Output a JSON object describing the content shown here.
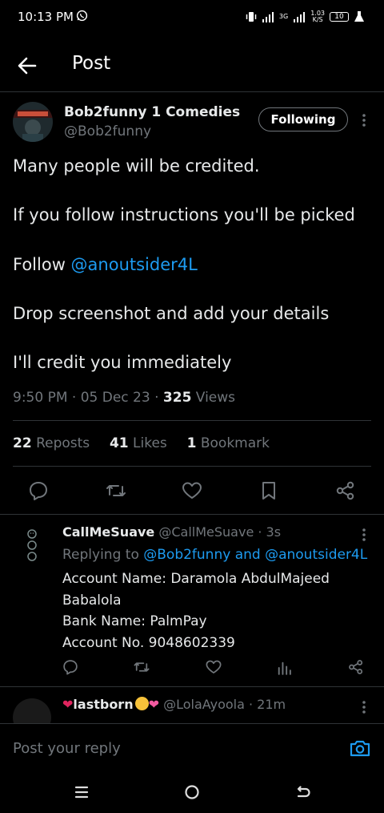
{
  "status": {
    "time": "10:13 PM",
    "network_top": "3G",
    "speed_value": "1.03",
    "speed_unit": "K/S",
    "battery": "10"
  },
  "header": {
    "title": "Post"
  },
  "tweet": {
    "author_name": "Bob2funny 1 Comedies",
    "author_handle": "@Bob2funny",
    "follow_label": "Following",
    "lines": [
      "Many people will be credited.",
      "If you follow instructions you'll be picked",
      "Follow ",
      "Drop screenshot and add your details",
      "I'll credit you immediately"
    ],
    "mention": "@anoutsider4L",
    "time": "9:50 PM",
    "sep1": " · ",
    "date": "05 Dec 23",
    "sep2": " · ",
    "views_count": "325",
    "views_label": " Views",
    "reposts_count": "22",
    "reposts_label": " Reposts",
    "likes_count": "41",
    "likes_label": " Likes",
    "bookmarks_count": "1",
    "bookmarks_label": " Bookmark"
  },
  "replies": [
    {
      "name": "CallMeSuave",
      "handle": " @CallMeSuave · 3s",
      "replying_prefix": "Replying to ",
      "replying_targets": "@Bob2funny and @anoutsider4L",
      "body": [
        "Account Name: Daramola AbdulMajeed",
        "Babalola",
        "Bank Name: PalmPay",
        "Account No. 9048602339"
      ]
    },
    {
      "name": "lastborn",
      "handle": " @LolaAyoola · 21m"
    }
  ],
  "composer": {
    "placeholder": "Post your reply"
  },
  "colors": {
    "accent": "#1d9bf0",
    "muted": "#71767b",
    "text": "#e7e9ea",
    "divider": "#2f3336"
  }
}
